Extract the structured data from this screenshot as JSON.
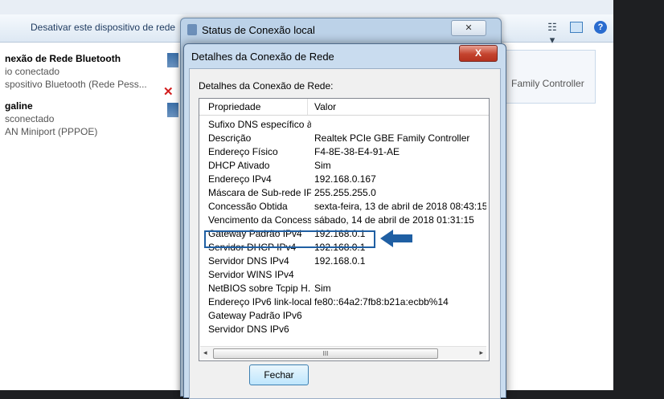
{
  "background": {
    "toolbar": {
      "disable_device_label": "Desativar este dispositivo de rede"
    },
    "connections": [
      {
        "title": "nexão de Rede Bluetooth",
        "status": "io conectado",
        "device": "spositivo Bluetooth (Rede Pess..."
      },
      {
        "title": "galine",
        "status": "sconectado",
        "device": "AN Miniport (PPPOE)"
      }
    ],
    "adapter_text": "Family Controller"
  },
  "status_dialog": {
    "title": "Status de Conexão local",
    "close_glyph": "✕"
  },
  "details_dialog": {
    "title": "Detalhes da Conexão de Rede",
    "close_glyph": "X",
    "section_label": "Detalhes da Conexão de Rede:",
    "columns": {
      "property": "Propriedade",
      "value": "Valor"
    },
    "rows": [
      {
        "property": "Sufixo DNS específico à...",
        "value": ""
      },
      {
        "property": "Descrição",
        "value": "Realtek PCIe GBE Family Controller"
      },
      {
        "property": "Endereço Físico",
        "value": "F4-8E-38-E4-91-AE"
      },
      {
        "property": "DHCP Ativado",
        "value": "Sim"
      },
      {
        "property": "Endereço IPv4",
        "value": "192.168.0.167"
      },
      {
        "property": "Máscara de Sub-rede IP...",
        "value": "255.255.255.0"
      },
      {
        "property": "Concessão Obtida",
        "value": "sexta-feira, 13 de abril de 2018 08:43:15"
      },
      {
        "property": "Vencimento da Concess...",
        "value": "sábado, 14 de abril de 2018 01:31:15"
      },
      {
        "property": "Gateway Padrão IPv4",
        "value": "192.168.0.1"
      },
      {
        "property": "Servidor DHCP IPv4",
        "value": "192.168.0.1"
      },
      {
        "property": "Servidor DNS IPv4",
        "value": "192.168.0.1"
      },
      {
        "property": "Servidor WINS IPv4",
        "value": ""
      },
      {
        "property": "NetBIOS sobre Tcpip H...",
        "value": "Sim"
      },
      {
        "property": "Endereço IPv6 link-local",
        "value": "fe80::64a2:7fb8:b21a:ecbb%14"
      },
      {
        "property": "Gateway Padrão IPv6",
        "value": ""
      },
      {
        "property": "Servidor DNS IPv6",
        "value": ""
      }
    ],
    "scrollbar": {
      "left_arrow": "◂",
      "right_arrow": "▸",
      "thumb_grip": "III"
    },
    "close_button_label": "Fechar"
  },
  "highlight": {
    "color": "#1f5fa3",
    "arrow_icon": "arrow-left-icon"
  }
}
